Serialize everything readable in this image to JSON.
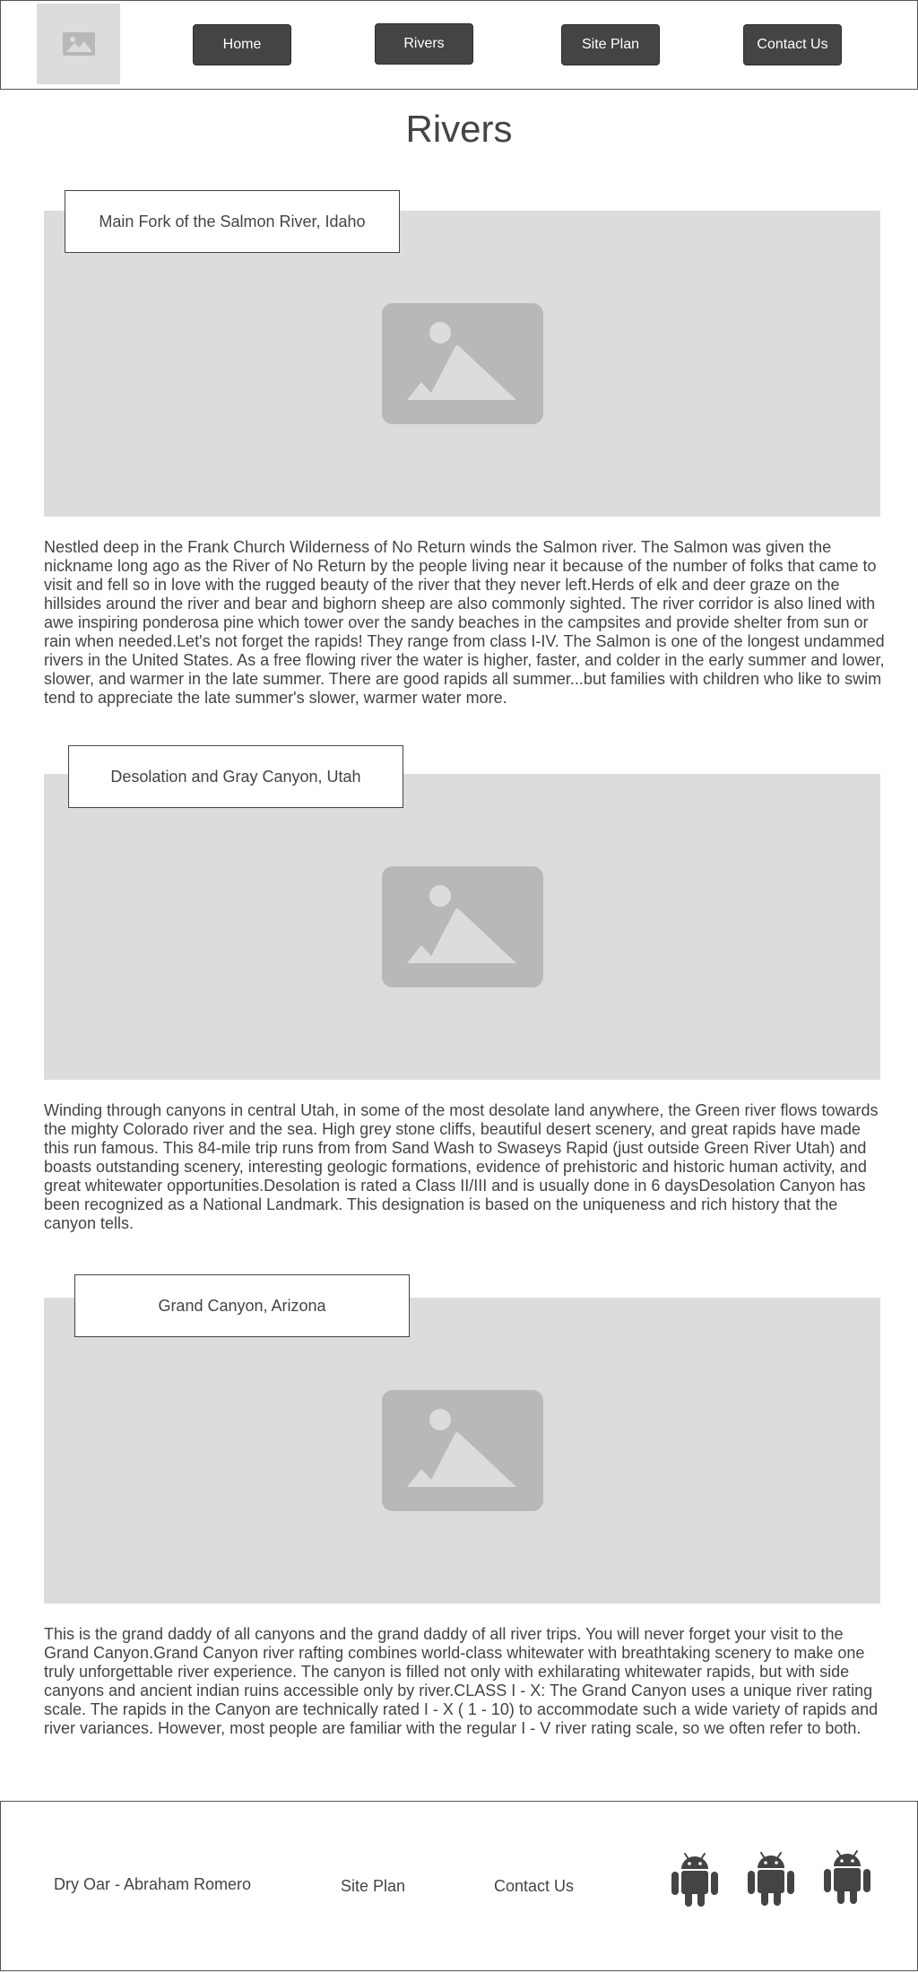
{
  "nav": {
    "home": "Home",
    "rivers": "Rivers",
    "site_plan": "Site Plan",
    "contact": "Contact Us"
  },
  "page": {
    "title": "Rivers"
  },
  "sections": [
    {
      "caption": "Main Fork of the Salmon River, Idaho",
      "description": "Nestled deep in the Frank Church Wilderness of No Return winds the Salmon river. The Salmon was given the nickname long ago as the River of No Return by the people living near it because of the number of folks that came to visit and fell so in love with the rugged beauty of the river that they never left.Herds of elk and deer graze on the hillsides around the river and bear and bighorn sheep are also commonly sighted. The river corridor is also lined with awe inspiring ponderosa pine which tower over the sandy beaches in the campsites and provide shelter from sun or rain when needed.Let's not forget the rapids! They range from class I-IV. The Salmon is one of the longest undammed rivers in the United States. As a free flowing river the water is higher, faster, and colder in the early summer and lower, slower, and warmer in the late summer. There are good rapids all summer...but families with children who like to swim tend to appreciate the late summer's slower, warmer water more."
    },
    {
      "caption": "Desolation and Gray Canyon, Utah",
      "description": "Winding through canyons in central Utah, in some of the most desolate land anywhere, the Green river flows towards the mighty Colorado river and the sea. High grey stone cliffs, beautiful desert scenery, and great rapids have made this run famous. This 84-mile trip runs from from Sand Wash to Swaseys Rapid (just outside Green River Utah) and boasts outstanding scenery, interesting geologic formations, evidence of prehistoric and historic human activity, and great whitewater opportunities.Desolation is rated a Class II/III and is usually done in 6 daysDesolation Canyon has been recognized as a National Landmark. This designation is based on the uniqueness and rich history that the canyon tells."
    },
    {
      "caption": "Grand Canyon, Arizona",
      "description": "This is the grand daddy of all canyons and the grand daddy of all river trips. You will never forget your visit to the Grand Canyon.Grand Canyon river rafting combines world-class whitewater with breathtaking scenery to make one truly unforgettable river experience. The canyon is filled not only with exhilarating whitewater rapids, but with side canyons and ancient indian ruins accessible only by river.CLASS I - X: The Grand Canyon uses a unique river rating scale. The rapids in the Canyon are technically rated I - X ( 1 - 10) to accommodate such a wide variety of rapids and river variances. However, most people are familiar with the regular I - V river rating scale, so we often refer to both."
    }
  ],
  "footer": {
    "credit": "Dry Oar - Abraham Romero",
    "site_plan": "Site Plan",
    "contact": "Contact Us",
    "icons": [
      "android-icon",
      "android-icon",
      "android-icon"
    ]
  },
  "colors": {
    "button_bg": "#444444",
    "placeholder_bg": "#dcdcdc",
    "placeholder_icon": "#b8b8b8",
    "text": "#444444"
  }
}
